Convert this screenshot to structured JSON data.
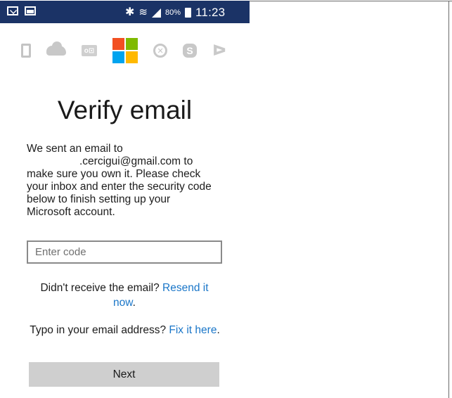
{
  "status_bar": {
    "battery_percent": "80%",
    "time": "11:23",
    "icons": [
      "mail-icon",
      "gallery-icon",
      "bluetooth-icon",
      "wifi-icon",
      "signal-icon",
      "battery-icon"
    ]
  },
  "apps": {
    "icons": [
      "office-icon",
      "onedrive-icon",
      "outlook-icon",
      "microsoft-logo-icon",
      "xbox-icon",
      "skype-icon",
      "bing-icon"
    ],
    "ms_colors": [
      "#f25022",
      "#7fba00",
      "#00a4ef",
      "#ffb900"
    ]
  },
  "page": {
    "title": "Verify email",
    "description_lines": [
      "We sent an email to",
      ".cercigui@gmail.com to",
      "make sure you own it. Please check",
      "your inbox and enter the security code",
      "below to finish setting up your",
      "Microsoft account."
    ]
  },
  "code_field": {
    "placeholder": "Enter code",
    "value": ""
  },
  "resend": {
    "prompt": "Didn't receive the email? ",
    "link_part1": "Resend it",
    "link_part2": "now",
    "suffix": "."
  },
  "typo": {
    "prompt": "Typo in your email address? ",
    "link": "Fix it here",
    "suffix": "."
  },
  "next_button": {
    "label": "Next"
  },
  "colors": {
    "status_bar_bg": "#1b3366",
    "link": "#1a76c8",
    "button_bg": "#cfcfcf"
  }
}
